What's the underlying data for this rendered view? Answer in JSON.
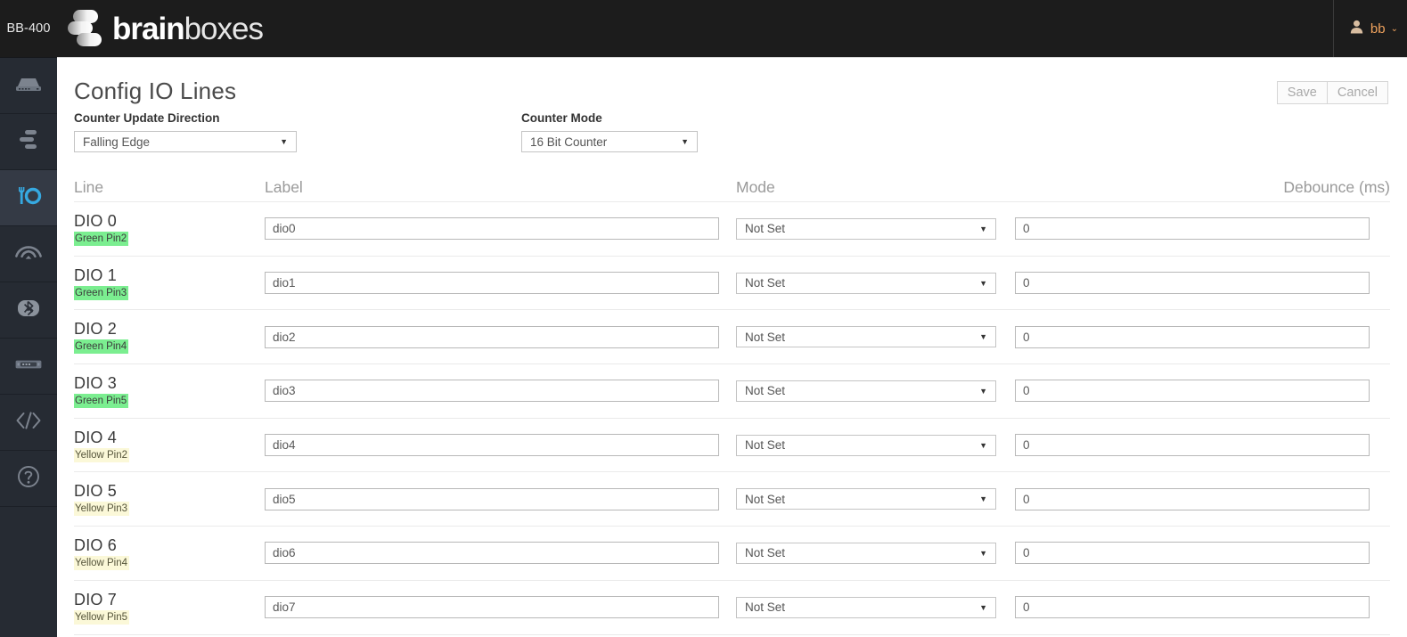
{
  "topbar": {
    "device_label": "BB-400",
    "logo_bold": "brain",
    "logo_light": "boxes",
    "user_icon": "user-icon",
    "user_name": "bb",
    "user_caret": "⌄"
  },
  "sidebar": {
    "items": [
      {
        "icon": "device-icon",
        "name": "sidebar-item-device",
        "active": false
      },
      {
        "icon": "network-icon",
        "name": "sidebar-item-network",
        "active": false
      },
      {
        "icon": "io-config-icon",
        "name": "sidebar-item-io-config",
        "active": true
      },
      {
        "icon": "wifi-icon",
        "name": "sidebar-item-wifi",
        "active": false
      },
      {
        "icon": "bluetooth-icon",
        "name": "sidebar-item-bluetooth",
        "active": false
      },
      {
        "icon": "serial-port-icon",
        "name": "sidebar-item-serial",
        "active": false
      },
      {
        "icon": "code-icon",
        "name": "sidebar-item-code",
        "active": false
      },
      {
        "icon": "help-icon",
        "name": "sidebar-item-help",
        "active": false
      }
    ]
  },
  "page": {
    "title": "Config IO Lines",
    "save_label": "Save",
    "cancel_label": "Cancel"
  },
  "fields": {
    "counter_update_direction": {
      "label": "Counter Update Direction",
      "value": "Falling Edge",
      "caret": "▼"
    },
    "counter_mode": {
      "label": "Counter Mode",
      "value": "16 Bit Counter",
      "caret": "▼"
    }
  },
  "table": {
    "headers": {
      "line": "Line",
      "label": "Label",
      "mode": "Mode",
      "debounce": "Debounce (ms)"
    },
    "caret": "▼",
    "rows": [
      {
        "line": "DIO 0",
        "pin": "Green Pin2",
        "pin_color": "green",
        "label": "dio0",
        "mode": "Not Set",
        "debounce": "0"
      },
      {
        "line": "DIO 1",
        "pin": "Green Pin3",
        "pin_color": "green",
        "label": "dio1",
        "mode": "Not Set",
        "debounce": "0"
      },
      {
        "line": "DIO 2",
        "pin": "Green Pin4",
        "pin_color": "green",
        "label": "dio2",
        "mode": "Not Set",
        "debounce": "0"
      },
      {
        "line": "DIO 3",
        "pin": "Green Pin5",
        "pin_color": "green",
        "label": "dio3",
        "mode": "Not Set",
        "debounce": "0"
      },
      {
        "line": "DIO 4",
        "pin": "Yellow Pin2",
        "pin_color": "yellow",
        "label": "dio4",
        "mode": "Not Set",
        "debounce": "0"
      },
      {
        "line": "DIO 5",
        "pin": "Yellow Pin3",
        "pin_color": "yellow",
        "label": "dio5",
        "mode": "Not Set",
        "debounce": "0"
      },
      {
        "line": "DIO 6",
        "pin": "Yellow Pin4",
        "pin_color": "yellow",
        "label": "dio6",
        "mode": "Not Set",
        "debounce": "0"
      },
      {
        "line": "DIO 7",
        "pin": "Yellow Pin5",
        "pin_color": "yellow",
        "label": "dio7",
        "mode": "Not Set",
        "debounce": "0"
      }
    ]
  },
  "colors": {
    "topbar_bg": "#1c1c1c",
    "sidebar_bg": "#262b33",
    "sidebar_active_bg": "#343a45",
    "accent_blue": "#36a9e1",
    "user_text": "#f0a35e",
    "pin_green": "#7bee90",
    "pin_yellow": "#fbf8d8"
  }
}
